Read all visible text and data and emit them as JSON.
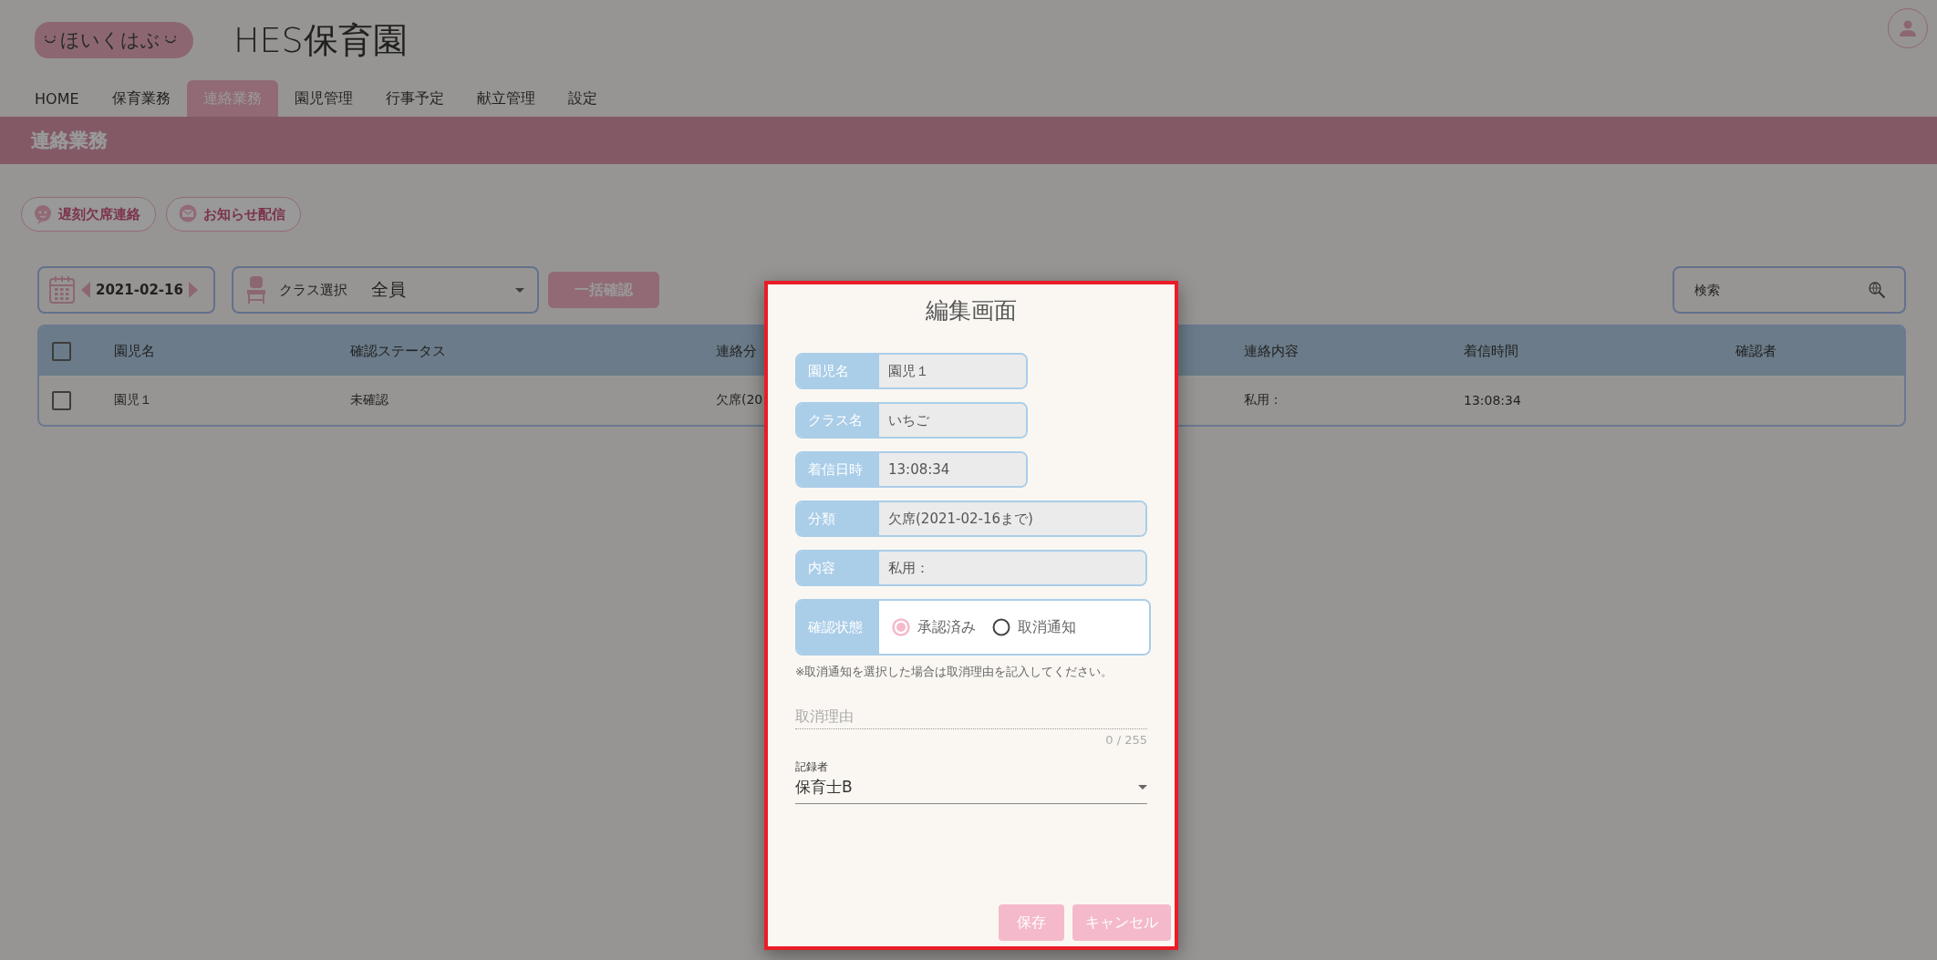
{
  "header": {
    "logo": "ほいくはぶ",
    "title": "HES保育園"
  },
  "nav_tabs": [
    {
      "label": "HOME",
      "selected": false
    },
    {
      "label": "保育業務",
      "selected": false
    },
    {
      "label": "連絡業務",
      "selected": true
    },
    {
      "label": "園児管理",
      "selected": false
    },
    {
      "label": "行事予定",
      "selected": false
    },
    {
      "label": "献立管理",
      "selected": false
    },
    {
      "label": "設定",
      "selected": false
    }
  ],
  "page_banner": "連絡業務",
  "action_buttons": [
    "遅刻欠席連絡",
    "お知らせ配信"
  ],
  "toolbar": {
    "date": "2021-02-16",
    "class_label": "クラス選択",
    "class_value": "全員",
    "bulk_button": "一括確認",
    "search_placeholder": "検索"
  },
  "table": {
    "header_checked": false,
    "columns": [
      "園児名",
      "確認ステータス",
      "連絡分",
      "連絡内容",
      "着信時間",
      "確認者"
    ],
    "rows": [
      {
        "checked": false,
        "cells": [
          "園児１",
          "未確認",
          "欠席(20",
          "私用：",
          "13:08:34"
        ]
      }
    ]
  },
  "dialog": {
    "title": "編集画面",
    "fields": [
      {
        "label": "園児名",
        "value": "園児１",
        "wide": false
      },
      {
        "label": "クラス名",
        "value": "いちご",
        "wide": false
      },
      {
        "label": "着信日時",
        "value": "13:08:34",
        "wide": false
      },
      {
        "label": "分類",
        "value": "欠席(2021-02-16まで)",
        "wide": true
      },
      {
        "label": "内容",
        "value": "私用：",
        "wide": true
      }
    ],
    "status": {
      "label": "確認状態",
      "options": [
        {
          "label": "承認済み",
          "selected": true
        },
        {
          "label": "取消通知",
          "selected": false
        }
      ]
    },
    "note": "※取消通知を選択した場合は取消理由を記入してください。",
    "reason": {
      "placeholder": "取消理由",
      "counter": "0 / 255"
    },
    "recorder": {
      "label": "記録者",
      "value": "保育士B"
    },
    "buttons": [
      "保存",
      "キャンセル"
    ]
  }
}
